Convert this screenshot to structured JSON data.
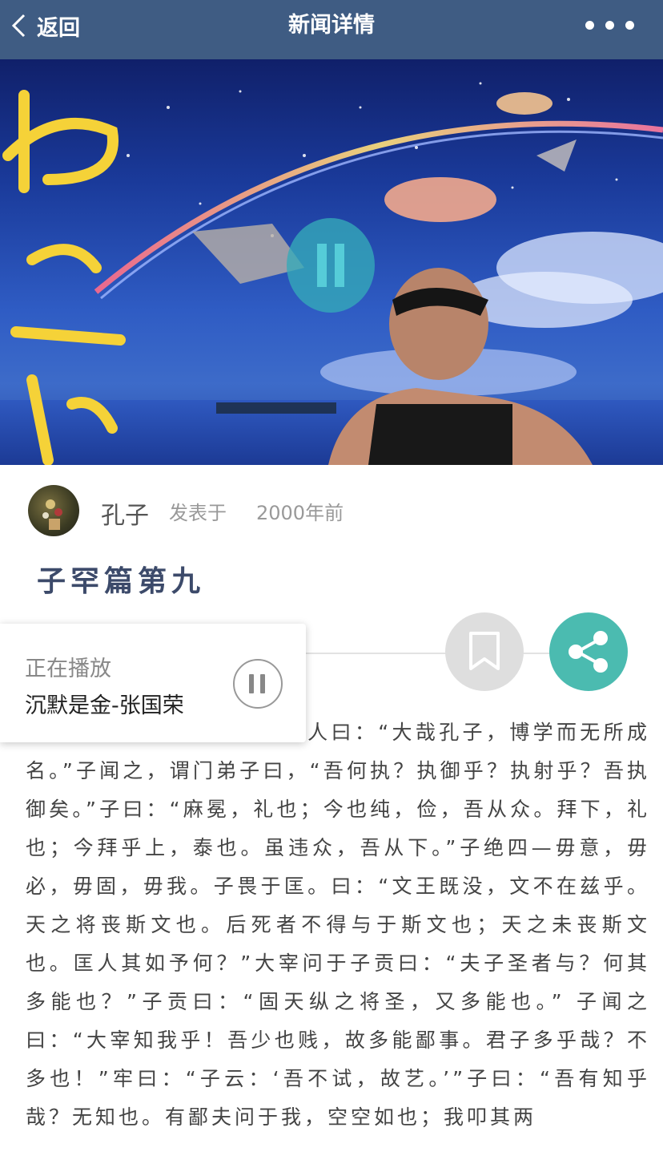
{
  "navbar": {
    "back_label": "返回",
    "title": "新闻详情",
    "background": "#3f5c83"
  },
  "article": {
    "author": "孔子",
    "published_prefix": "发表于",
    "published_time": "2000年前",
    "title": "子罕篇第九",
    "body": "子罕言利与命与仁。达巷党人曰：“大哉孔子，博学而无所成名。”子闻之，谓门弟子曰，“吾何执？执御乎？执射乎？吾执御矣。”子曰：“麻冕，礼也；今也纯，俭，吾从众。拜下，礼也；今拜乎上，泰也。虽违众，吾从下。”子绝四—毋意，毋必，毋固，毋我。子畏于匡。曰：“文王既没，文不在兹乎。天之将丧斯文也。后死者不得与于斯文也；天之未丧斯文也。匡人其如予何？”大宰问于子贡曰：“夫子圣者与？何其多能也？”子贡曰：“固天纵之将圣，又多能也。” 子闻之曰：“大宰知我乎！吾少也贱，故多能鄙事。君子多乎哉？不多也！”牢曰：“子云：‘吾不试，故艺。’”子曰：“吾有知乎哉？无知也。有鄙夫问于我，空空如也；我叩其两"
  },
  "player": {
    "status": "正在播放",
    "song": "沉默是金-张国荣"
  },
  "colors": {
    "accent_share": "#4bbbb0",
    "bookmark_bg": "#dedede",
    "title_text": "#3c4a6a"
  },
  "icons": {
    "back": "chevron-left-icon",
    "more": "more-dots-icon",
    "bookmark": "bookmark-icon",
    "share": "share-icon",
    "pause": "pause-icon"
  }
}
